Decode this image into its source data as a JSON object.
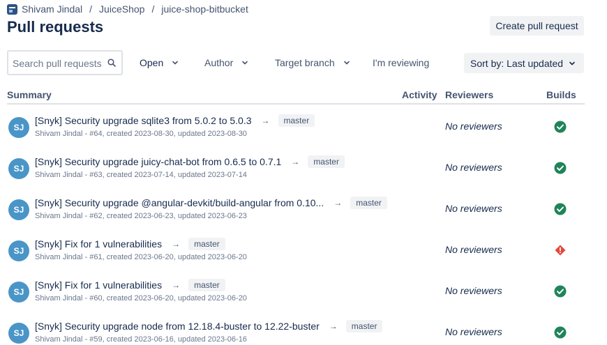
{
  "breadcrumb": {
    "user": "Shivam Jindal",
    "project": "JuiceShop",
    "repo": "juice-shop-bitbucket",
    "separator": "/"
  },
  "page": {
    "title": "Pull requests",
    "create_label": "Create pull request"
  },
  "filters": {
    "search_placeholder": "Search pull requests",
    "state": "Open",
    "author": "Author",
    "target_branch": "Target branch",
    "reviewing": "I'm reviewing",
    "sort": "Sort by: Last updated"
  },
  "columns": {
    "summary": "Summary",
    "activity": "Activity",
    "reviewers": "Reviewers",
    "builds": "Builds"
  },
  "colors": {
    "build_success": "#1f845a",
    "build_failed": "#e2483d",
    "avatar": "#4a95c8"
  },
  "pull_requests": [
    {
      "initials": "SJ",
      "title": "[Snyk] Security upgrade sqlite3 from 5.0.2 to 5.0.3",
      "arrow": "→",
      "branch": "master",
      "meta": "Shivam Jindal - #64, created 2023-08-30, updated 2023-08-30",
      "reviewers": "No reviewers",
      "build_status": "success",
      "build_icon": "check-circle-icon"
    },
    {
      "initials": "SJ",
      "title": "[Snyk] Security upgrade juicy-chat-bot from 0.6.5 to 0.7.1",
      "arrow": "→",
      "branch": "master",
      "meta": "Shivam Jindal - #63, created 2023-07-14, updated 2023-07-14",
      "reviewers": "No reviewers",
      "build_status": "success",
      "build_icon": "check-circle-icon"
    },
    {
      "initials": "SJ",
      "title": "[Snyk] Security upgrade @angular-devkit/build-angular from 0.10...",
      "arrow": "→",
      "branch": "master",
      "meta": "Shivam Jindal - #62, created 2023-06-23, updated 2023-06-23",
      "reviewers": "No reviewers",
      "build_status": "success",
      "build_icon": "check-circle-icon"
    },
    {
      "initials": "SJ",
      "title": "[Snyk] Fix for 1 vulnerabilities",
      "arrow": "→",
      "branch": "master",
      "meta": "Shivam Jindal - #61, created 2023-06-20, updated 2023-06-20",
      "reviewers": "No reviewers",
      "build_status": "failed",
      "build_icon": "error-diamond-icon"
    },
    {
      "initials": "SJ",
      "title": "[Snyk] Fix for 1 vulnerabilities",
      "arrow": "→",
      "branch": "master",
      "meta": "Shivam Jindal - #60, created 2023-06-20, updated 2023-06-20",
      "reviewers": "No reviewers",
      "build_status": "success",
      "build_icon": "check-circle-icon"
    },
    {
      "initials": "SJ",
      "title": "[Snyk] Security upgrade node from 12.18.4-buster to 12.22-buster",
      "arrow": "→",
      "branch": "master",
      "meta": "Shivam Jindal - #59, created 2023-06-16, updated 2023-06-16",
      "reviewers": "No reviewers",
      "build_status": "success",
      "build_icon": "check-circle-icon"
    }
  ]
}
